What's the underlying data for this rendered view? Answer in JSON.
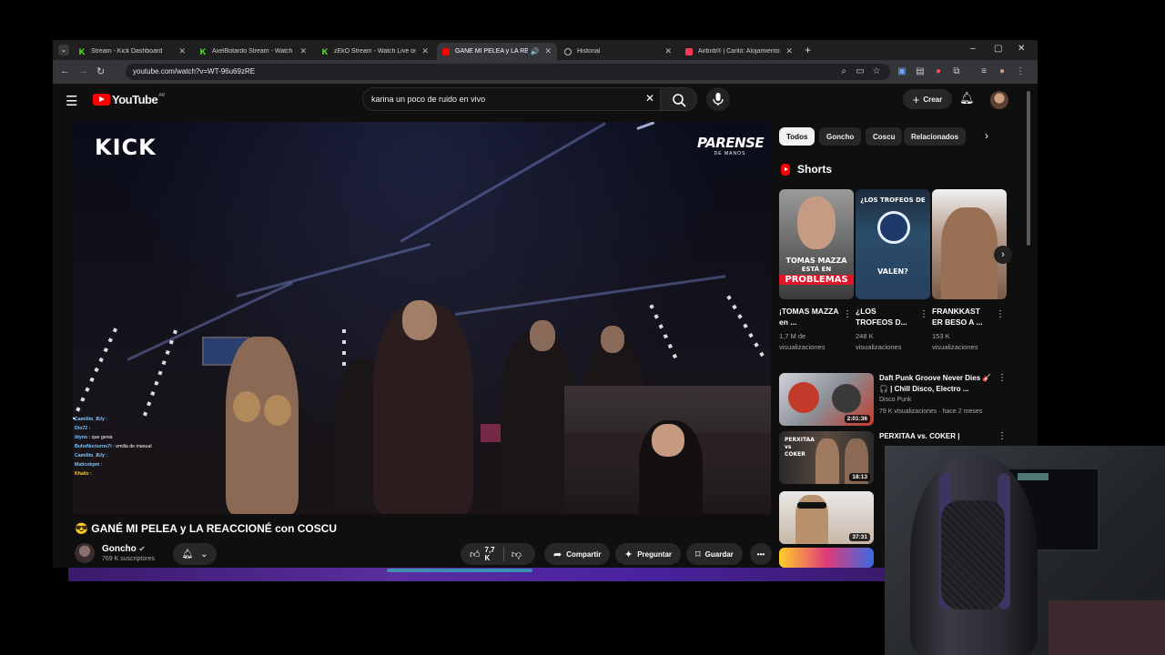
{
  "browser": {
    "tabs": [
      {
        "title": "Stream - Kick Dashboard",
        "icon": "kick-icon",
        "active": false
      },
      {
        "title": "AxelBotardo Stream - Watch Li",
        "icon": "kick-icon",
        "active": false
      },
      {
        "title": "zEkO Stream - Watch Live on Ki",
        "icon": "kick-icon",
        "active": false
      },
      {
        "title": "GANÉ MI PELEA y LA RE",
        "icon": "youtube-icon",
        "active": true
      },
      {
        "title": "Historial",
        "icon": "history-icon",
        "active": false
      },
      {
        "title": "Airbnb® | Cariló: Alojamientos",
        "icon": "airbnb-icon",
        "active": false
      }
    ],
    "url": "youtube.com/watch?v=WT-96u69zRE"
  },
  "masthead": {
    "logo_text": "YouTube",
    "country_code": "AR",
    "search_value": "karina un poco de ruido en vivo",
    "create_label": "Crear"
  },
  "player": {
    "kick_logo": "KICK",
    "event_logo": "PARENSE",
    "event_logo_sub": "DE MANOS",
    "chat": [
      {
        "user": "Camilito_8Uy :",
        "msg": "",
        "color": "blue"
      },
      {
        "user": "Dio72 :",
        "msg": "",
        "color": "blue"
      },
      {
        "user": "tityno :",
        "msg": "que genia",
        "color": "blue"
      },
      {
        "user": "BuhoNocturno7i :",
        "msg": "emilia de manual",
        "color": "blue"
      },
      {
        "user": "Camilito_8Uy :",
        "msg": "",
        "color": "blue"
      },
      {
        "user": "Maticobpm :",
        "msg": "",
        "color": "blue"
      },
      {
        "user": "Khaltz :",
        "msg": "",
        "color": "gold"
      }
    ]
  },
  "video": {
    "title": "😎 GANÉ MI PELEA y LA REACCIONÉ con COSCU",
    "channel": "Goncho",
    "subscribers": "769 K suscriptores",
    "likes": "7,7 K",
    "share_label": "Compartir",
    "ask_label": "Preguntar",
    "save_label": "Guardar"
  },
  "sidebar": {
    "chips": [
      "Todos",
      "Goncho",
      "Coscu",
      "Relacionados"
    ],
    "shorts_title": "Shorts",
    "shorts": [
      {
        "title": "¡TOMAS MAZZA en ...",
        "views": "1,7 M de visualizaciones",
        "caption1": "TOMAS MAZZA",
        "caption2": "ESTÁ EN",
        "caption3": "PROBLEMAS"
      },
      {
        "title": "¿LOS TROFEOS D...",
        "views": "248 K visualizaciones",
        "caption1": "¿LOS TROFEOS DE",
        "caption2": "VALEN?"
      },
      {
        "title": "FRANKKAST ER BESO A ...",
        "views": "153 K visualizaciones"
      }
    ],
    "related": [
      {
        "title": "Daft Punk Groove Never Dies 🎸🎧 | Chill Disco, Electro ...",
        "channel": "Disco Punk",
        "meta": "79 K visualizaciones · hace 2 meses",
        "duration": "2:01:36"
      },
      {
        "title": "PERXITAA vs. COKER |",
        "channel": "",
        "meta": "",
        "duration": "18:13"
      },
      {
        "title": "",
        "channel": "",
        "meta": "",
        "duration": "37:31"
      },
      {
        "title": "",
        "channel": "",
        "meta": "",
        "duration": ""
      }
    ]
  }
}
